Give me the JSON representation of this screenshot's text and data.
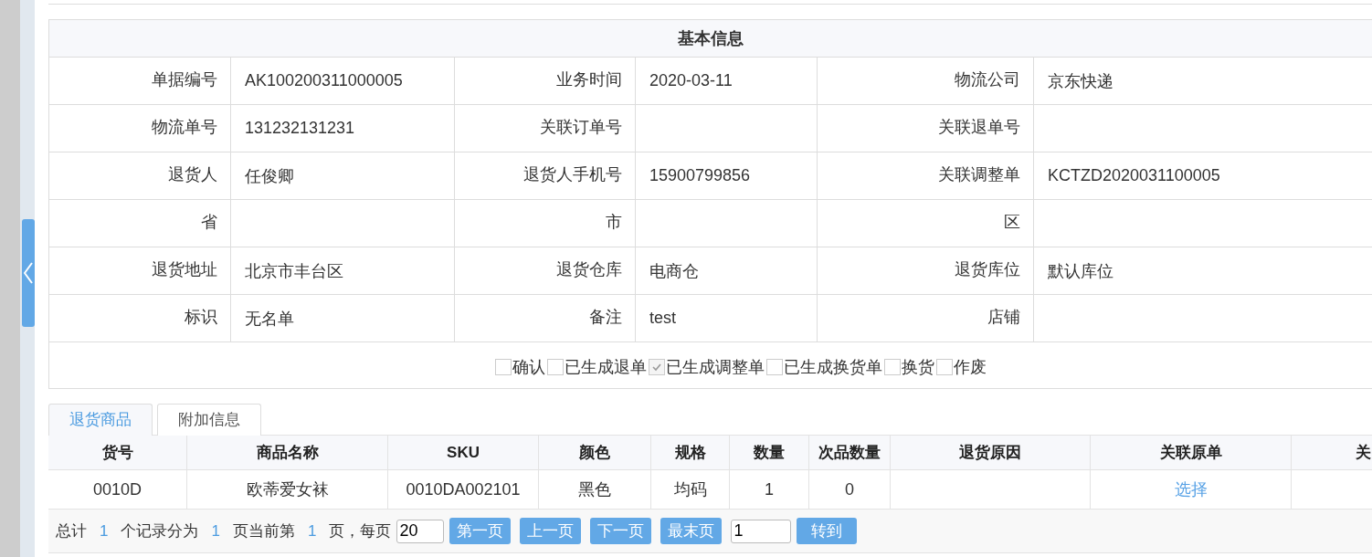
{
  "info_panel": {
    "title": "基本信息",
    "rows": [
      [
        {
          "label": "单据编号",
          "value": "AK100200311000005"
        },
        {
          "label": "业务时间",
          "value": "2020-03-11"
        },
        {
          "label": "物流公司",
          "value": "京东快递"
        }
      ],
      [
        {
          "label": "物流单号",
          "value": "131232131231"
        },
        {
          "label": "关联订单号"
        },
        {
          "label": "关联退单号"
        }
      ],
      [
        {
          "label": "退货人",
          "value": "任俊卿"
        },
        {
          "label": "退货人手机号",
          "value": "15900799856"
        },
        {
          "label": "关联调整单",
          "value": "KCTZD2020031100005"
        }
      ],
      [
        {
          "label": "省"
        },
        {
          "label": "市"
        },
        {
          "label": "区"
        }
      ],
      [
        {
          "label": "退货地址",
          "value": "北京市丰台区"
        },
        {
          "label": "退货仓库",
          "value": "电商仓"
        },
        {
          "label": "退货库位",
          "value": "默认库位"
        }
      ],
      [
        {
          "label": "标识",
          "value": "无名单"
        },
        {
          "label": "备注",
          "value": "test"
        },
        {
          "label": "店铺"
        }
      ]
    ],
    "flags": [
      {
        "label": "确认",
        "checked": false
      },
      {
        "label": "已生成退单",
        "checked": false
      },
      {
        "label": "已生成调整单",
        "checked": true
      },
      {
        "label": "已生成换货单",
        "checked": false
      },
      {
        "label": "换货",
        "checked": false
      },
      {
        "label": "作废",
        "checked": false
      }
    ]
  },
  "tabs": [
    {
      "label": "退货商品",
      "selected": true
    },
    {
      "label": "附加信息",
      "selected": false
    }
  ],
  "goods_table": {
    "columns": [
      "货号",
      "商品名称",
      "SKU",
      "颜色",
      "规格",
      "数量",
      "次品数量",
      "退货原因",
      "关联原单",
      "关"
    ],
    "rows": [
      [
        {
          "text": "0010D"
        },
        {
          "text": "欧蒂爱女袜"
        },
        {
          "text": "0010DA002101"
        },
        {
          "text": "黑色"
        },
        {
          "text": "均码"
        },
        {
          "text": "1"
        },
        {
          "text": "0"
        },
        {},
        {
          "text": "选择",
          "kind": "link"
        },
        {}
      ]
    ]
  },
  "pager": {
    "items": [
      {
        "kind": "text",
        "text": "总计"
      },
      {
        "kind": "number",
        "text": "1"
      },
      {
        "kind": "text",
        "text": "个记录分为"
      },
      {
        "kind": "number",
        "text": "1"
      },
      {
        "kind": "text",
        "text": "页当前第"
      },
      {
        "kind": "number",
        "text": "1"
      },
      {
        "kind": "text",
        "text": "页，每页"
      },
      {
        "kind": "input",
        "text": "20"
      },
      {
        "kind": "button",
        "text": "第一页"
      },
      {
        "kind": "button",
        "text": "上一页"
      },
      {
        "kind": "button",
        "text": "下一页"
      },
      {
        "kind": "button",
        "text": "最末页"
      },
      {
        "kind": "input",
        "text": "1"
      },
      {
        "kind": "button",
        "text": "转到"
      }
    ]
  }
}
